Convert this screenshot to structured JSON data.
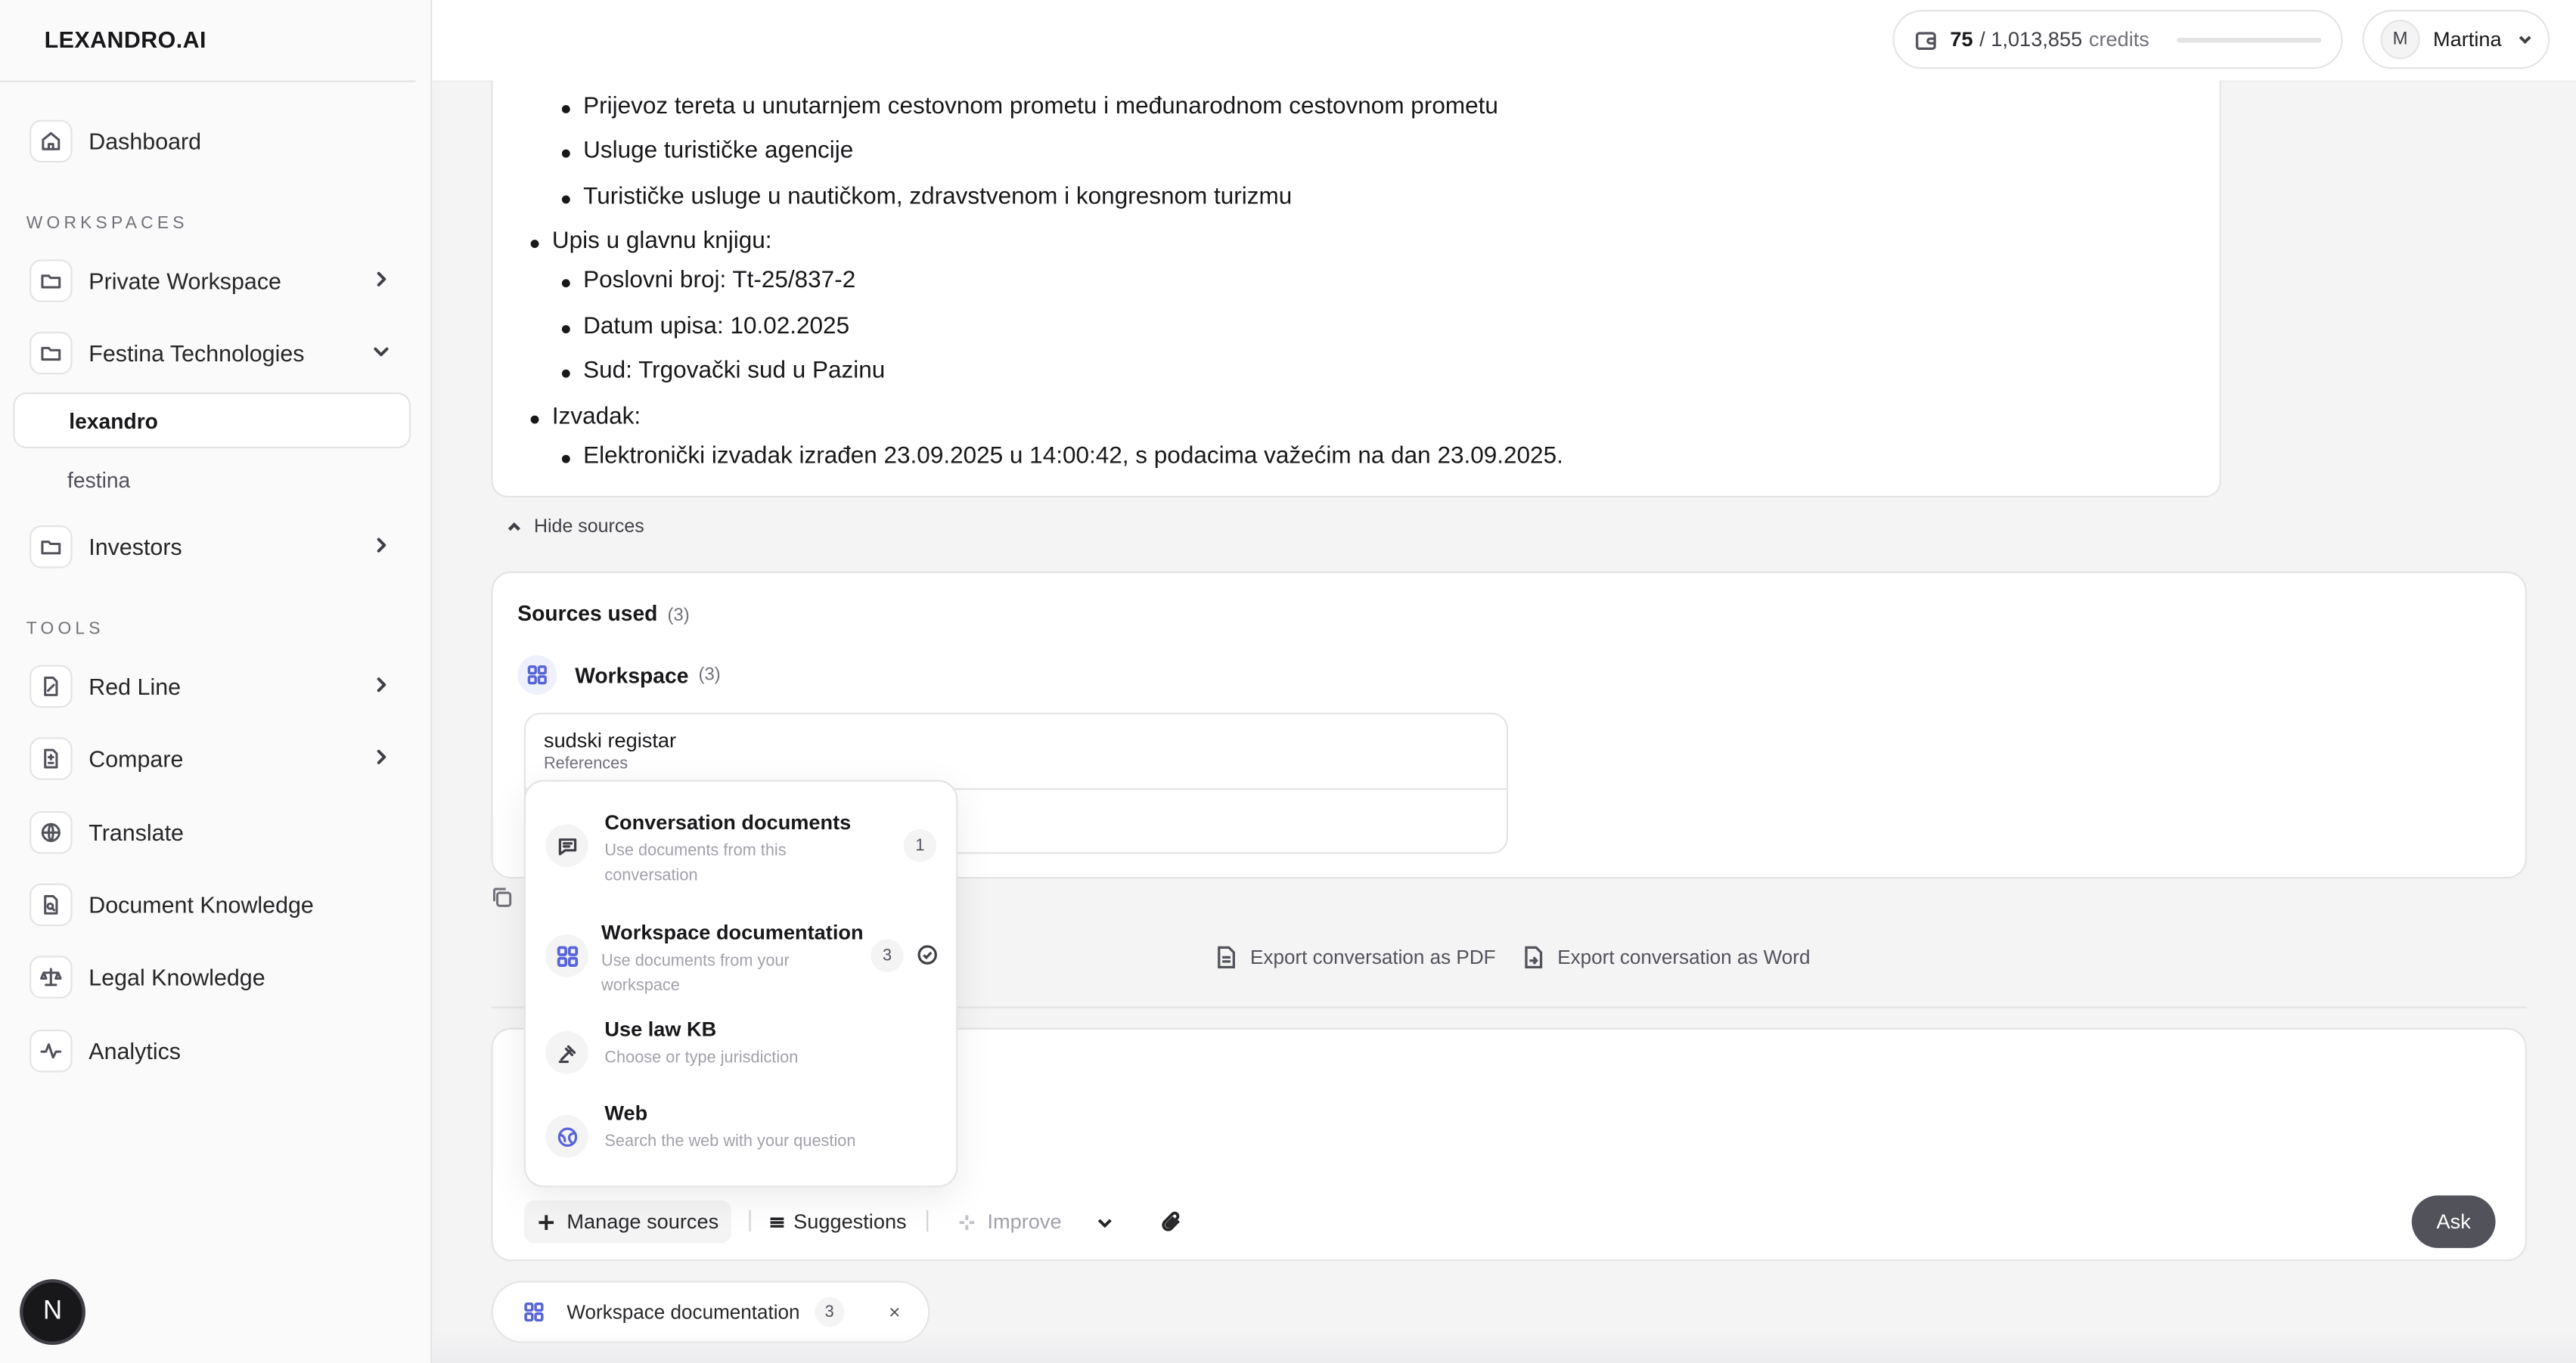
{
  "app": {
    "logo": "LEXANDRO.AI"
  },
  "sidebar": {
    "dashboard": "Dashboard",
    "workspaces_label": "WORKSPACES",
    "workspaces": [
      {
        "label": "Private Workspace"
      },
      {
        "label": "Festina Technologies"
      }
    ],
    "sub_items": [
      {
        "label": "lexandro"
      },
      {
        "label": "festina"
      }
    ],
    "investors": "Investors",
    "tools_label": "TOOLS",
    "tools": [
      {
        "label": "Red Line"
      },
      {
        "label": "Compare"
      },
      {
        "label": "Translate"
      },
      {
        "label": "Document Knowledge"
      },
      {
        "label": "Legal Knowledge"
      },
      {
        "label": "Analytics"
      }
    ],
    "badge": "N"
  },
  "header": {
    "credits_used": "75",
    "credits_total": "/ 1,013,855",
    "credits_unit": "credits",
    "credits_fraction": 0.0001,
    "user_initial": "M",
    "user_name": "Martina"
  },
  "answer": {
    "lines": [
      {
        "text": "Prijevoz tereta u unutarnjem cestovnom prometu i međunarodnom cestovnom prometu"
      },
      {
        "text": "Usluge turističke agencije"
      },
      {
        "text": "Turističke usluge u nautičkom, zdravstvenom i kongresnom turizmu"
      },
      {
        "text": "Upis u glavnu knjigu:"
      },
      {
        "text": "Poslovni broj: Tt-25/837-2"
      },
      {
        "text": "Datum upisa: 10.02.2025"
      },
      {
        "text": "Sud: Trgovački sud u Pazinu"
      },
      {
        "text": "Izvadak:"
      },
      {
        "text": "Elektronički izvadak izrađen 23.09.2025 u 14:00:42, s podacima važećim na dan 23.09.2025."
      }
    ]
  },
  "sources": {
    "hide_label": "Hide sources",
    "title": "Sources used",
    "count": "(3)",
    "workspace_label": "Workspace",
    "workspace_count": "(3)",
    "doc_title": "sudski registar",
    "doc_subtitle": "References"
  },
  "export": {
    "pdf": "Export conversation as PDF",
    "word": "Export conversation as Word"
  },
  "popover": {
    "items": [
      {
        "title": "Conversation documents",
        "desc": "Use documents from this conversation",
        "badge": "1"
      },
      {
        "title": "Workspace documentation",
        "desc": "Use documents from your workspace",
        "badge": "3"
      },
      {
        "title": "Use law KB",
        "desc": "Choose or type jurisdiction"
      },
      {
        "title": "Web",
        "desc": "Search the web with your question"
      }
    ]
  },
  "composer": {
    "manage": "Manage sources",
    "suggestions": "Suggestions",
    "improve": "Improve",
    "ask": "Ask"
  },
  "chip": {
    "label": "Workspace documentation",
    "count": "3",
    "close": "×"
  }
}
